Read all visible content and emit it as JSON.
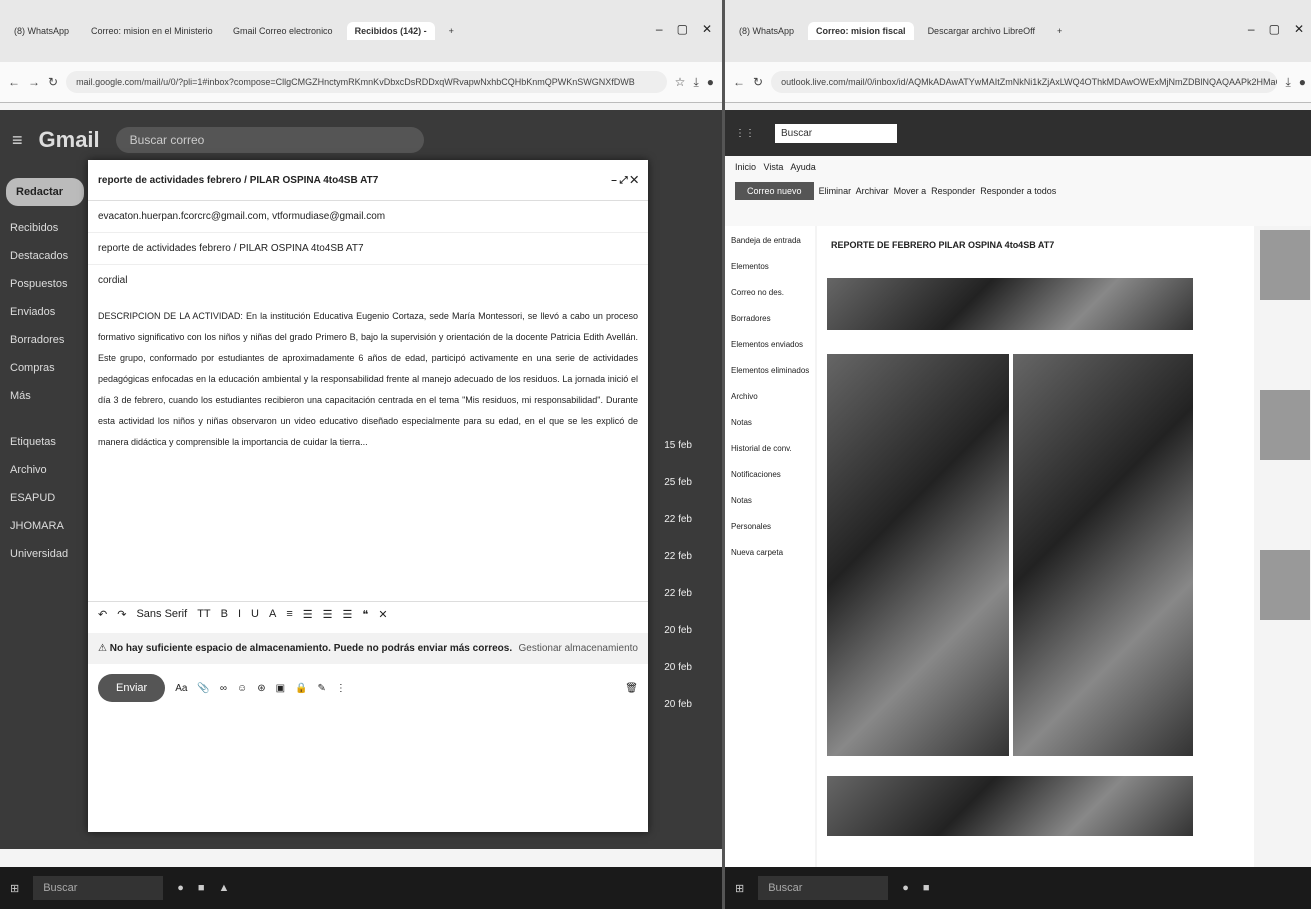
{
  "left": {
    "tabs": [
      "(8) WhatsApp",
      "Correo: mision en el Ministerio",
      "Gmail Correo electronico",
      "Recibidos (142) - ",
      "+"
    ],
    "url": "mail.google.com/mail/u/0/?pli=1#inbox?compose=CllgCMGZHnctymRKmnKvDbxcDsRDDxqWRvapwNxhbCQHbKnmQPWKnSWGNXfDWB",
    "gmail": {
      "logo": "Gmail",
      "search": "Buscar correo",
      "compose_label": "Redactar",
      "folders": [
        "Recibidos",
        "Destacados",
        "Pospuestos",
        "Enviados",
        "Borradores",
        "Compras",
        "Más"
      ],
      "labels_title": "Etiquetas",
      "labels": [
        "Archivo",
        "ESAPUD",
        "JHOMARA",
        "Universidad"
      ],
      "dates": [
        "15 feb",
        "25 feb",
        "22 feb",
        "22 feb",
        "22 feb",
        "20 feb",
        "20 feb",
        "20 feb"
      ]
    },
    "compose": {
      "title": "reporte de actividades febrero / PILAR OSPINA 4to4SB AT7",
      "to": "evacaton.huerpan.fcorcrc@gmail.com, vtformudiase@gmail.com",
      "subject": "reporte de actividades febrero / PILAR OSPINA 4to4SB AT7",
      "greeting": "cordial",
      "body": "DESCRIPCION DE LA ACTIVIDAD: En la institución Educativa Eugenio Cortaza, sede María Montessori, se llevó a cabo un proceso formativo significativo con los niños y niñas del grado Primero B, bajo la supervisión y orientación de la docente Patricia Edith Avellán. Este grupo, conformado por estudiantes de aproximadamente 6 años de edad, participó activamente en una serie de actividades pedagógicas enfocadas en la educación ambiental y la responsabilidad frente al manejo adecuado de los residuos. La jornada inició el día 3 de febrero, cuando los estudiantes recibieron una capacitación centrada en el tema \"Mis residuos, mi responsabilidad\". Durante esta actividad los niños y niñas observaron un video educativo diseñado especialmente para su edad, en el que se les explicó de manera didáctica y comprensible la importancia de cuidar la tierra...",
      "format": [
        "↶",
        "↷",
        "Sans Serif",
        "TT",
        "B",
        "I",
        "U",
        "A",
        "≡",
        "☰",
        "☰",
        "☰",
        "❝",
        "✕"
      ],
      "warning": "No hay suficiente espacio de almacenamiento. Puede no podrás enviar más correos.",
      "manage": "Gestionar almacenamiento",
      "send": "Enviar",
      "tools": [
        "Aa",
        "📎",
        "∞",
        "☺",
        "⊛",
        "▣",
        "🔒",
        "✎",
        "⋮"
      ],
      "trash": "🗑"
    },
    "taskbar_search": "Buscar"
  },
  "right": {
    "tabs": [
      "(8) WhatsApp",
      "Correo: mision fiscal",
      "Descargar archivo LibreOff",
      "+"
    ],
    "url": "outlook.live.com/mail/0/inbox/id/AQMkADAwATYwMAItZmNkNi1kZjAxLWQ4OThkMDAwOWExMjNmZDBlNQAQAAPk2HMaQ2OJ",
    "search": "Buscar",
    "menu": [
      "Inicio",
      "Vista",
      "Ayuda"
    ],
    "new_mail": "Correo nuevo",
    "actions": [
      "Eliminar",
      "Archivar",
      "Mover a",
      "Responder",
      "Responder a todos"
    ],
    "folders": [
      "Bandeja de entrada",
      "Elementos",
      "Correo no des.",
      "Borradores",
      "Elementos enviados",
      "Elementos eliminados",
      "Archivo",
      "Notas",
      "Historial de conv.",
      "Notificaciones",
      "Notas",
      "Personales",
      "Nueva carpeta"
    ],
    "subject": "REPORTE DE FEBRERO PILAR OSPINA 4to4SB AT7",
    "taskbar_search": "Buscar"
  }
}
